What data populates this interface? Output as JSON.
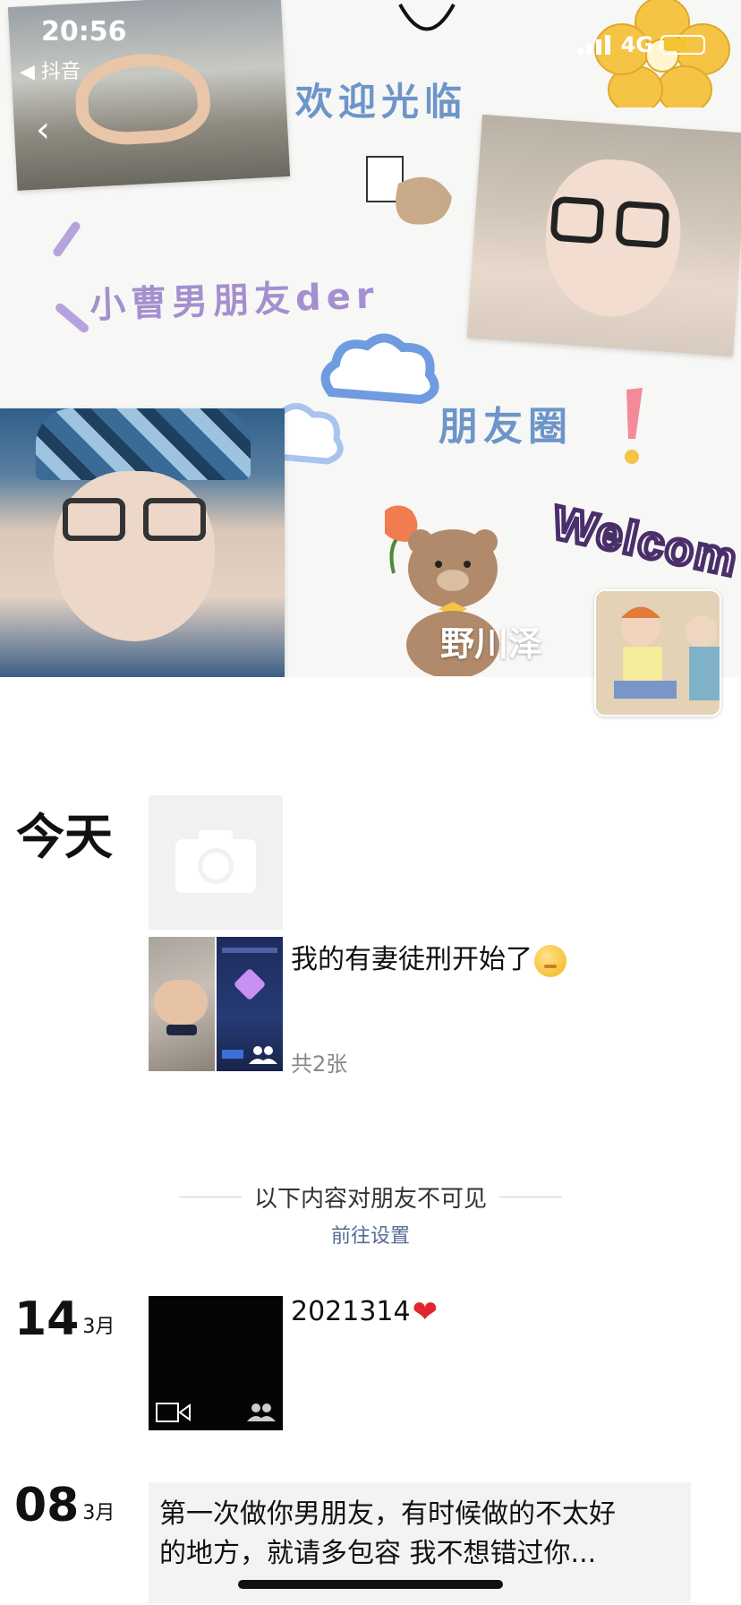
{
  "status_bar": {
    "time": "20:56",
    "back_app": "◀ 抖音",
    "network": "4G",
    "battery_level": 0.6
  },
  "cover": {
    "stickers": {
      "welcome_top": "欢迎光临",
      "boyfriend_der": "小曹男朋友der",
      "moments": "朋友圈",
      "welcome_banner": "Welcom"
    },
    "nickname": "野川泽",
    "colors": {
      "sticker_blue": "#6d95c9",
      "sticker_purple": "#a48fcf",
      "flower": "#f6c445"
    }
  },
  "timeline": {
    "today_label": "今天",
    "post1": {
      "text": "我的有妻徒刑开始了",
      "count": "共2张"
    },
    "privacy_notice": "以下内容对朋友不可见",
    "privacy_link": "前往设置",
    "post2": {
      "day": "14",
      "month": "3月",
      "text": "2021314",
      "emoji": "❤"
    },
    "post3": {
      "day": "08",
      "month": "3月",
      "line1": "第一次做你男朋友，有时候做的不太好",
      "line2": "的地方，就请多包容 我不想错过你..."
    }
  }
}
